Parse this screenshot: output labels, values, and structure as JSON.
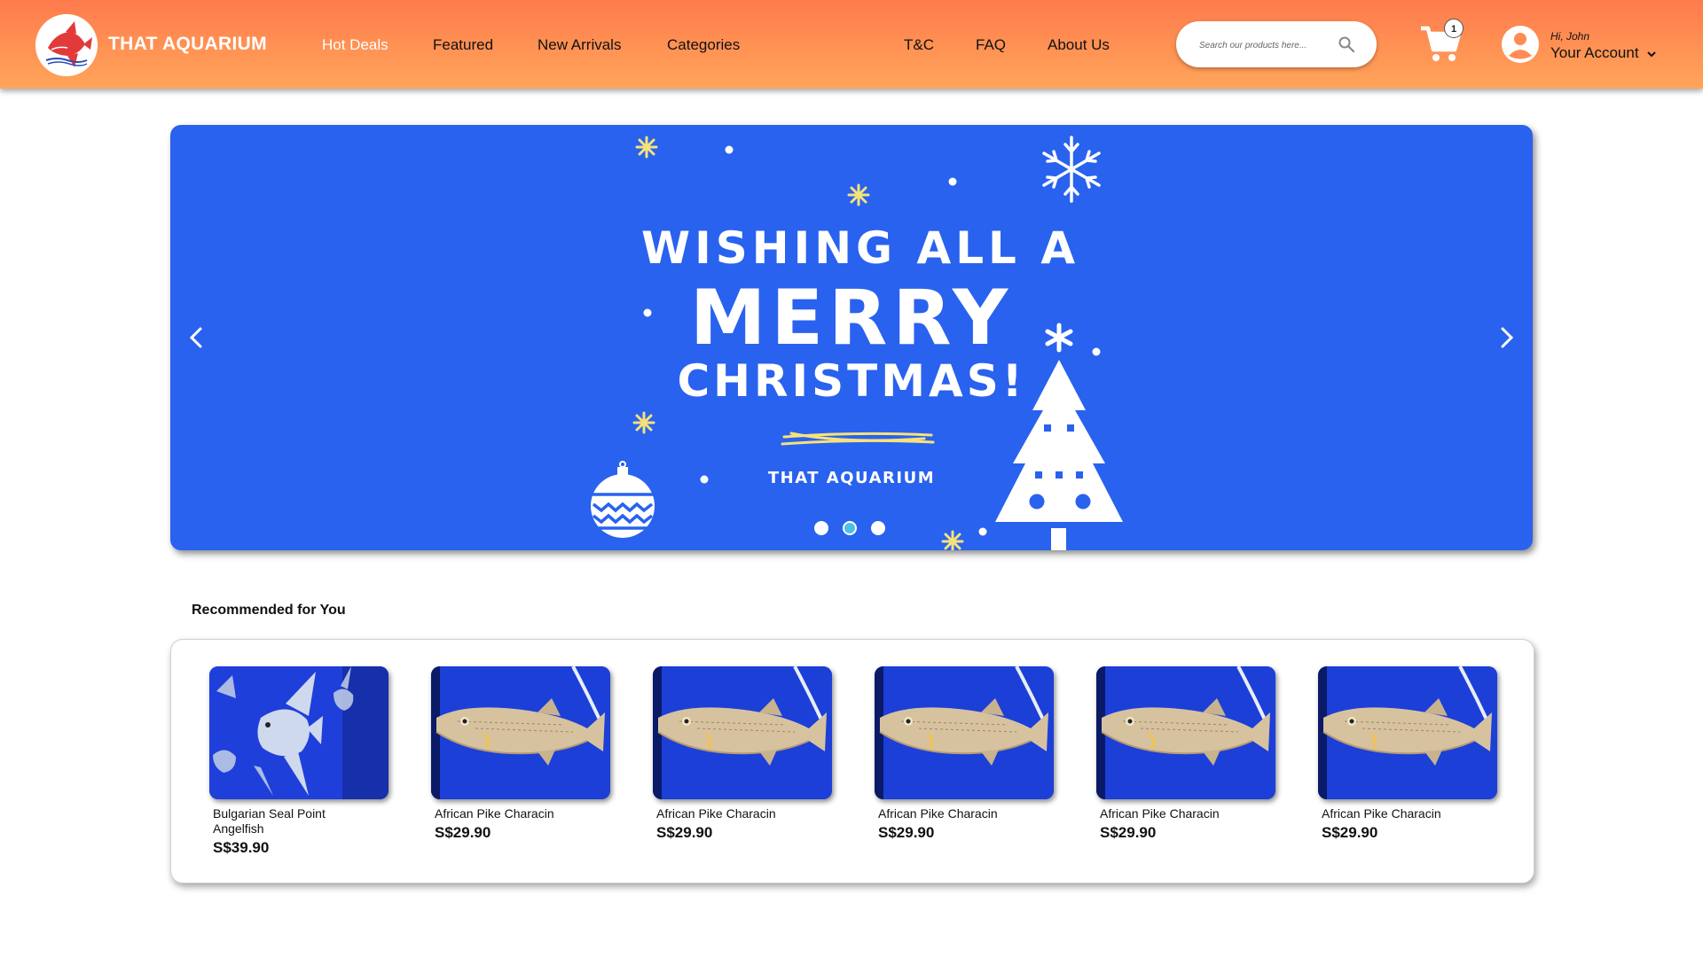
{
  "brand": {
    "name": "THAT AQUARIUM",
    "logo_icon": "angelfish-logo-icon"
  },
  "nav": {
    "items": [
      {
        "label": "Hot Deals",
        "active": true
      },
      {
        "label": "Featured",
        "active": false
      },
      {
        "label": "New Arrivals",
        "active": false
      },
      {
        "label": "Categories",
        "active": false
      }
    ],
    "secondary": [
      {
        "label": "T&C"
      },
      {
        "label": "FAQ"
      },
      {
        "label": "About Us"
      }
    ]
  },
  "search": {
    "placeholder": "Search our products here...",
    "value": "",
    "icon": "search-icon"
  },
  "cart": {
    "icon": "cart-icon",
    "count": "1"
  },
  "account": {
    "greeting": "Hi, John",
    "label": "Your Account",
    "icon": "user-avatar-icon"
  },
  "banner": {
    "line1": "WISHING ALL A",
    "line2": "MERRY",
    "line3": "CHRISTMAS!",
    "brand": "THAT AQUARIUM",
    "background": "#2962ee",
    "slide_count": 3,
    "active_slide": 2,
    "prev_icon": "chevron-left-icon",
    "next_icon": "chevron-right-icon"
  },
  "recommended": {
    "title": "Recommended for You",
    "products": [
      {
        "name": "Bulgarian Seal Point Angelfish",
        "price": "S$39.90",
        "image": "angelfish"
      },
      {
        "name": "African Pike Characin",
        "price": "S$29.90",
        "image": "pike"
      },
      {
        "name": "African Pike Characin",
        "price": "S$29.90",
        "image": "pike"
      },
      {
        "name": "African Pike Characin",
        "price": "S$29.90",
        "image": "pike"
      },
      {
        "name": "African Pike Characin",
        "price": "S$29.90",
        "image": "pike"
      },
      {
        "name": "African Pike Characin",
        "price": "S$29.90",
        "image": "pike"
      }
    ]
  },
  "colors": {
    "header_start": "#ff7b4c",
    "header_end": "#ffa55a",
    "accent_dot": "#4bc0e8"
  }
}
